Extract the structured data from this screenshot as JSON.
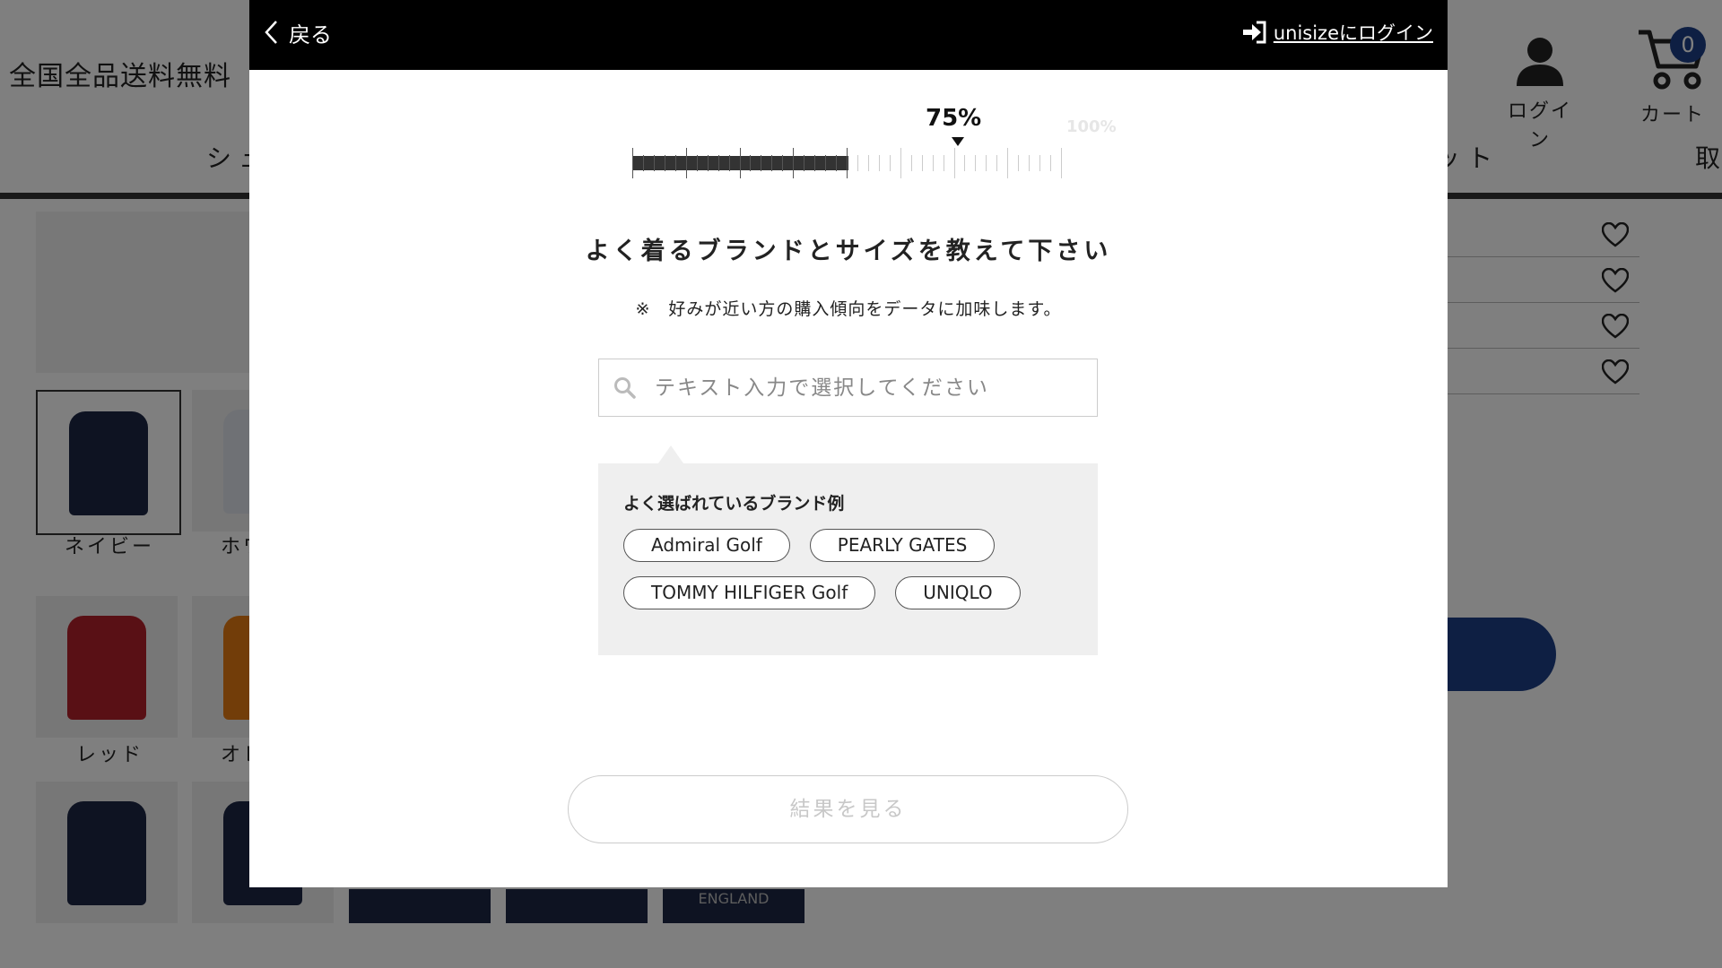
{
  "background": {
    "promo_text": "全国全品送料無料",
    "nav_left_partial": "シュ",
    "nav_right_partial": "ット",
    "nav_far_partial": "取",
    "login_label": "ログイン",
    "cart_label": "カート",
    "cart_count": "0",
    "swatches": [
      {
        "label": "ネイビー",
        "color": "#1d2744"
      },
      {
        "label": "ホワ",
        "color": "#dfe3ea"
      },
      {
        "label": "レッド",
        "color": "#b3202a"
      },
      {
        "label": "オレ",
        "color": "#e57a12"
      }
    ],
    "tile_text": "ENGLAND",
    "accent_color": "#1c3f86"
  },
  "modal": {
    "back_label": "戻る",
    "external_login_label": "unisizeにログイン",
    "progress": {
      "percent": 75,
      "percent_label": "75%",
      "max_label": "100%"
    },
    "title": "よく着るブランドとサイズを教えて下さい",
    "note": "※　好みが近い方の購入傾向をデータに加味します。",
    "search": {
      "placeholder": "テキスト入力で選択してください",
      "value": ""
    },
    "suggestions": {
      "title": "よく選ばれているブランド例",
      "brands": [
        "Admiral Golf",
        "PEARLY GATES",
        "TOMMY HILFIGER Golf",
        "UNIQLO"
      ]
    },
    "result_button_label": "結果を見る"
  }
}
